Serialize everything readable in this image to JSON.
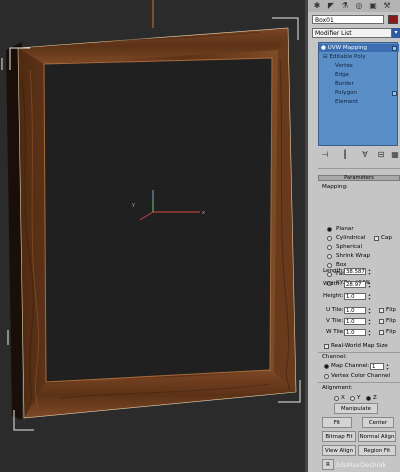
{
  "panel": {
    "object_name": "Box01",
    "modifier_list": "Modifier List",
    "stack": [
      {
        "label": "UVW Mapping",
        "selected": true
      },
      {
        "label": "Editable Poly",
        "selected": false
      },
      {
        "label": "Vertex",
        "selected": false
      },
      {
        "label": "Edge",
        "selected": false
      },
      {
        "label": "Border",
        "selected": false
      },
      {
        "label": "Polygon",
        "selected": false
      },
      {
        "label": "Element",
        "selected": false
      }
    ],
    "parameters_title": "Parameters",
    "mapping_title": "Mapping:",
    "mapping_options": [
      "Planar",
      "Cylindrical",
      "Spherical",
      "Shrink Wrap",
      "Box",
      "Face",
      "XYZ to UVW"
    ],
    "mapping_selected": "Planar",
    "cap_label": "Cap",
    "length_label": "Length:",
    "length_value": "38.587",
    "width_label": "Width:",
    "width_value": "28.97",
    "height_label": "Height:",
    "height_value": "1.0",
    "u_tile_label": "U Tile:",
    "u_tile_value": "1.0",
    "v_tile_label": "V Tile:",
    "v_tile_value": "1.0",
    "w_tile_label": "W Tile:",
    "w_tile_value": "1.0",
    "flip_label": "Flip",
    "real_world_label": "Real-World Map Size",
    "channel_title": "Channel:",
    "map_channel_label": "Map Channel:",
    "map_channel_value": "1",
    "vertex_color_label": "Vertex Color Channel",
    "alignment_title": "Alignment:",
    "axis_x": "X",
    "axis_y": "Y",
    "axis_z": "Z",
    "manipulate_label": "Manipulate",
    "fit_label": "Fit",
    "center_label": "Center",
    "bitmap_fit_label": "Bitmap Fit",
    "normal_align_label": "Normal Align",
    "view_align_label": "View Align",
    "region_fit_label": "Region Fit",
    "reset_label": "R"
  },
  "watermark": "3dsMaxDeshnik",
  "colors": {
    "wood": "#6b3a1c",
    "stack_bg": "#5a8ec7",
    "panel_bg": "#c5c5c5",
    "viewport_bg": "#2b2b2b"
  }
}
